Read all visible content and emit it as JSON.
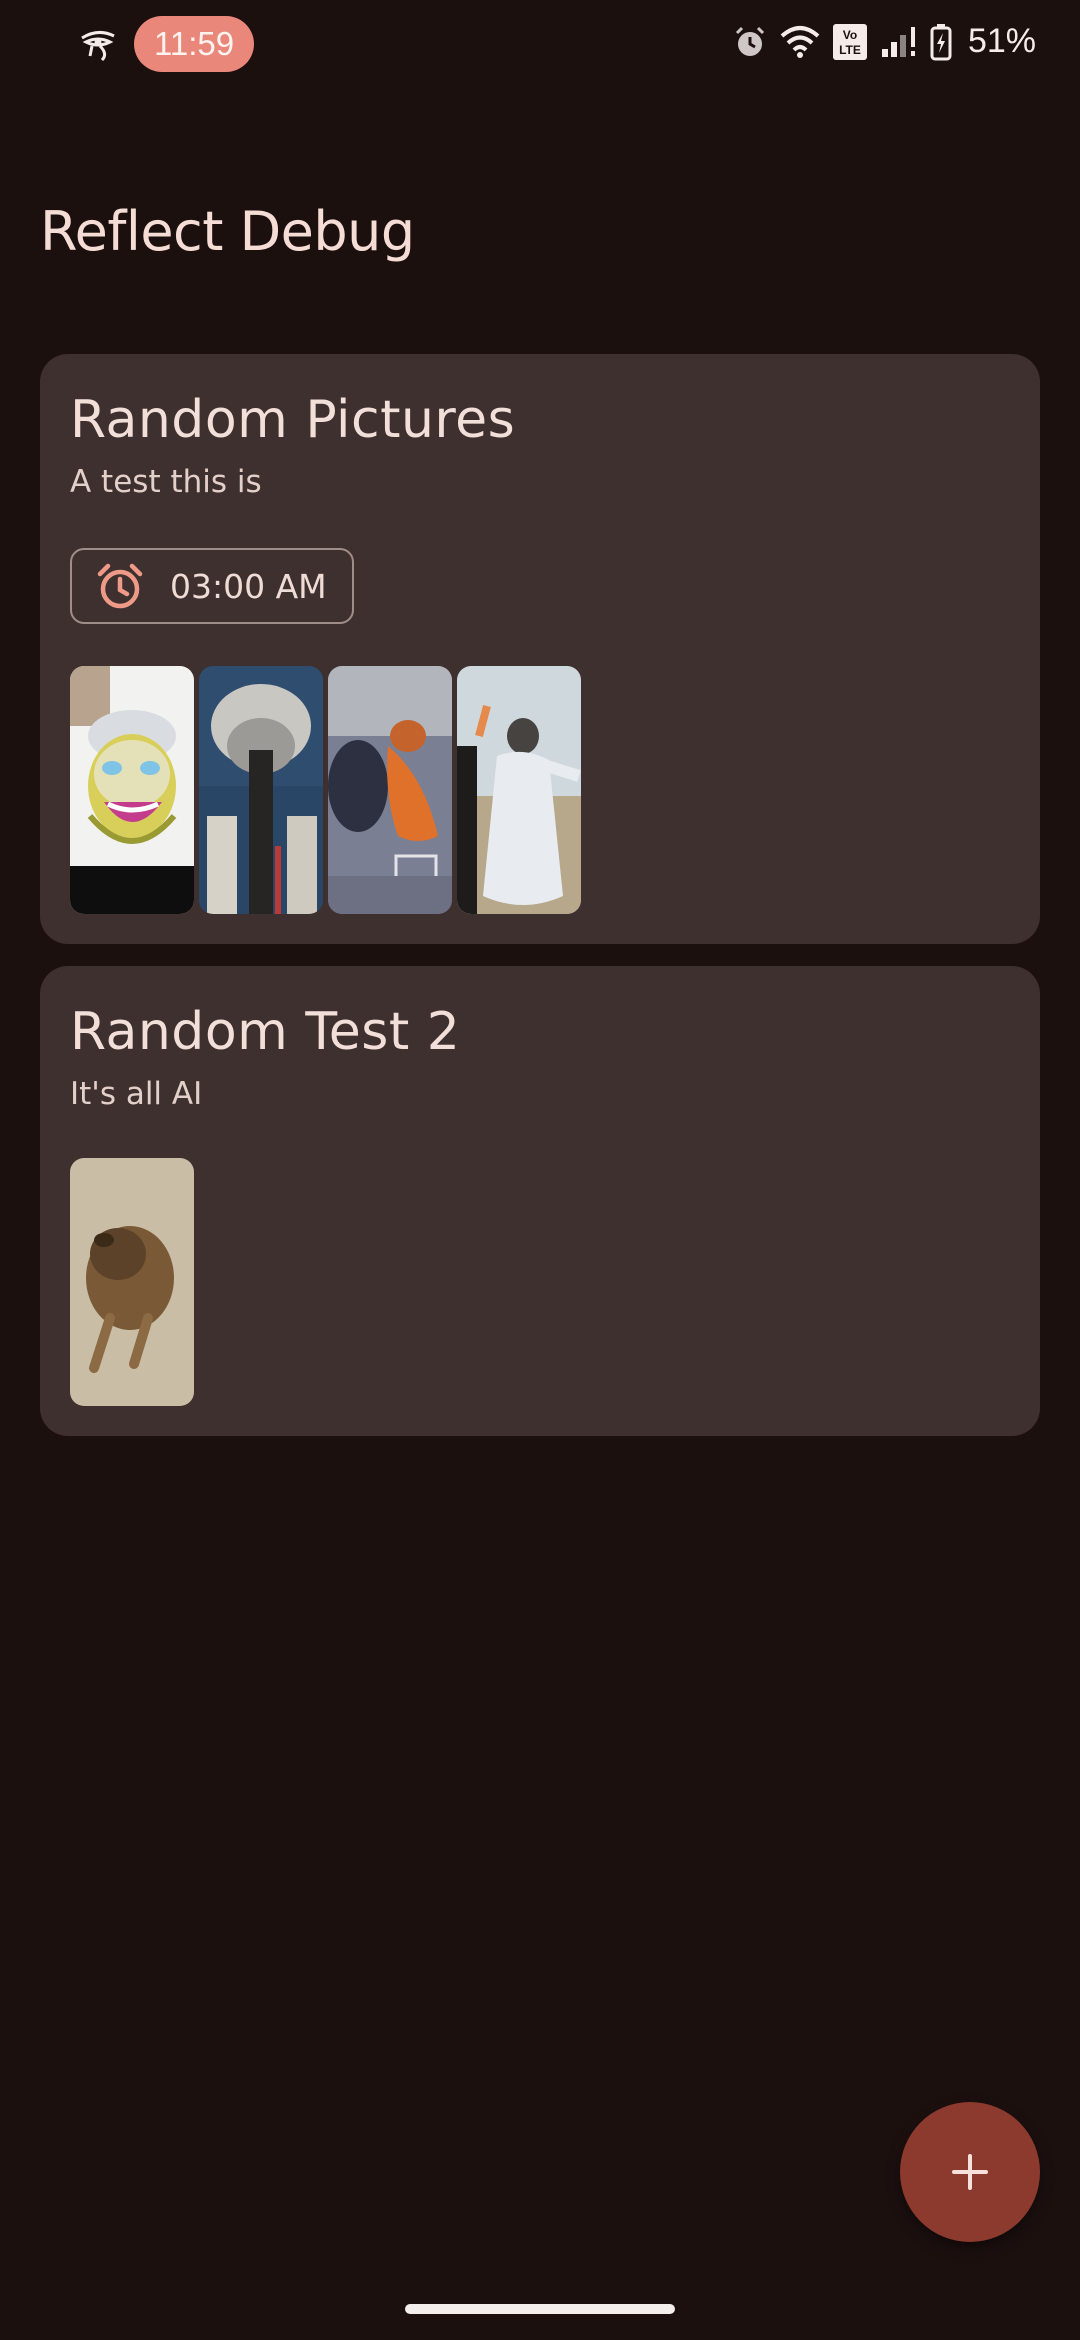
{
  "status_bar": {
    "time": "11:59",
    "battery": "51%",
    "network_badge": "Vo LTE",
    "icons": [
      "eye-of-horus-icon",
      "alarm-icon",
      "wifi-icon",
      "volte-icon",
      "signal-icon",
      "battery-charging-icon"
    ]
  },
  "app": {
    "title": "Reflect Debug"
  },
  "cards": [
    {
      "title": "Random Pictures",
      "subtitle": "A test this is",
      "alarm_time": "03:00 AM",
      "thumbnails": [
        "meme-face-image",
        "gray-hair-figure-image",
        "street-crowd-orange-image",
        "white-dress-dancer-image"
      ]
    },
    {
      "title": "Random Test 2",
      "subtitle": "It's all AI",
      "thumbnails": [
        "sleeping-dog-image"
      ]
    }
  ],
  "fab": {
    "icon": "plus-icon"
  },
  "colors": {
    "background": "#1c100f",
    "card": "#3e302e",
    "accent_pill": "#e8877a",
    "fab": "#8d3a2e",
    "alarm_icon": "#ef9a89"
  }
}
